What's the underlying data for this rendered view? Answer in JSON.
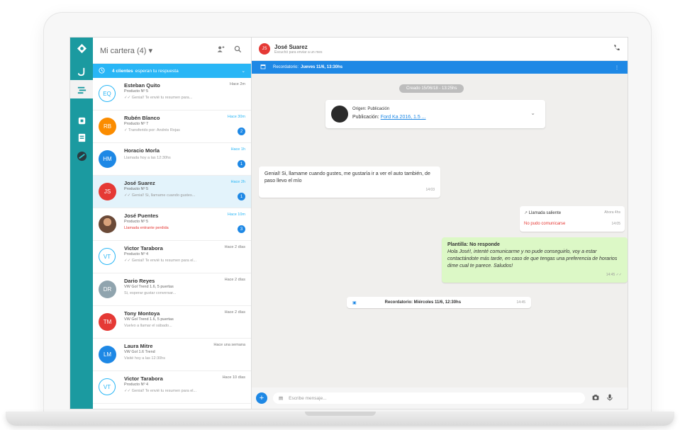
{
  "sidebar": {
    "title": "Mi cartera (4)",
    "title_caret": "▾",
    "banner_bold": "4 clientes",
    "banner_text": "esperan tu respuesta",
    "banner_chevron": "⌄"
  },
  "contacts": [
    {
      "initials": "EQ",
      "name": "Esteban Quito",
      "product": "Producto Nº 5",
      "last": "✓✓ Genial! Te envié tu resumen para...",
      "time": "Hace 2m",
      "badge": ""
    },
    {
      "initials": "RB",
      "name": "Rubén Blanco",
      "product": "Producto Nº 7",
      "last": "✓ Transferido por: Andrés Rojas",
      "time": "Hace 30m",
      "badge": "2"
    },
    {
      "initials": "HM",
      "name": "Horacio Morla",
      "product": "",
      "last": "Llamada hoy a las 12:30hs",
      "time": "Hace 1h",
      "badge": "1"
    },
    {
      "initials": "JS",
      "name": "José Suarez",
      "product": "Producto Nº 5",
      "last": "✓✓ Genial! Si, llamame cuando gustes...",
      "time": "Hace 2h",
      "badge": "1"
    },
    {
      "initials": "",
      "name": "José Puentes",
      "product": "Producto Nº 5",
      "last": "Llamada entrante perdida",
      "time": "Hace 10m",
      "badge": "3"
    },
    {
      "initials": "VT",
      "name": "Victor Tarabora",
      "product": "Producto Nº 4",
      "last": "✓✓ Genial! Te envié tu resumen para el...",
      "time": "Hace 2 días",
      "badge": ""
    },
    {
      "initials": "DR",
      "name": "Dario Reyes",
      "product": "VW Gol Trend 1.6, 5 puertas",
      "last": "Si, esperar gustar conversar...",
      "time": "Hace 2 días",
      "badge": ""
    },
    {
      "initials": "TM",
      "name": "Tony Montoya",
      "product": "VW Gol Trend 1.6, 5 puertas",
      "last": "Vuelvo a llamar el sábado...",
      "time": "Hace 2 días",
      "badge": ""
    },
    {
      "initials": "LM",
      "name": "Laura Mitre",
      "product": "VW Gol 1.6 Trend",
      "last": "Visité hoy a las 12:30hs",
      "time": "Hace una semana",
      "badge": ""
    },
    {
      "initials": "VT",
      "name": "Victor Tarabora",
      "product": "Producto Nº 4",
      "last": "✓✓ Genial! Te envié tu resumen para el...",
      "time": "Hace 10 días",
      "badge": ""
    }
  ],
  "chat": {
    "contact_initials": "JS",
    "contact_name": "José Suarez",
    "contact_status": "Escuchó para enviar a un mes",
    "reminder_label": "Recordatorio:",
    "reminder_bold": "Jueves 11/6, 13:30hs",
    "reminder_menu": "⋮",
    "date_pill": "Creado 15/06/18 - 13:25hs",
    "origin_label": "Origen: Publicación",
    "origin_value_label": "Publicación:",
    "origin_link": "Ford Ka 2016, 1.5 ...",
    "origin_chevron": "⌄",
    "incoming_text": "Genial! Si, llamame cuando gustes, me gustaría ir a ver el auto también, de paso llevo el mío",
    "incoming_time": "14:03",
    "call_title": "Llamada saliente",
    "call_time": "Ahora 4hs",
    "call_status": "No pudo comunicarse",
    "call_status_time": "14:05",
    "template_title_label": "Plantilla:",
    "template_title": "No responde",
    "template_text": "Hola José!, intenté comunicarme y no pude conseguirlo, voy a estar contactándote más tarde, en caso de que tengas una preferencia de horarios dime cual te parece. Saludos!",
    "template_time": "14:45 ✓✓",
    "remind_text": "Recordatorio: Miércoles 11/6, 12:30hs",
    "remind_time": "14:45",
    "composer_placeholder": "Escribe mensaje..."
  },
  "colors": {
    "teal": "#1b9aa0",
    "blue": "#29b6f6",
    "red": "#e53935",
    "orange": "#fb8c00"
  }
}
